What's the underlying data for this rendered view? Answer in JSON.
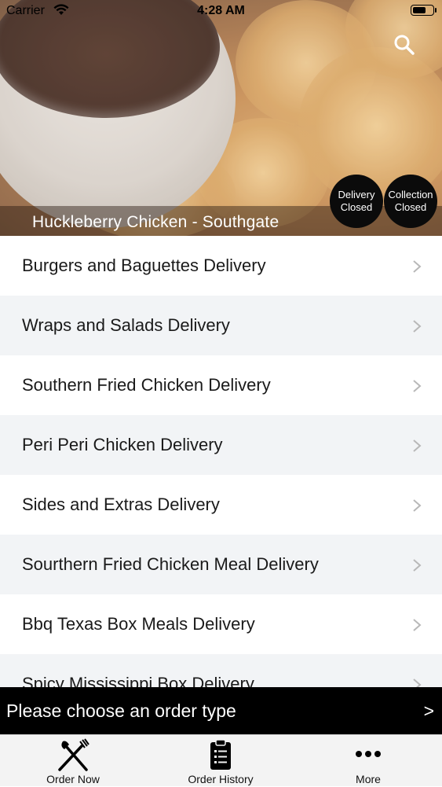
{
  "status_bar": {
    "carrier": "Carrier",
    "time": "4:28 AM"
  },
  "hero": {
    "restaurant_name": "Huckleberry Chicken - Southgate",
    "delivery_badge": [
      "Delivery",
      "Closed"
    ],
    "collection_badge": [
      "Collection",
      "Closed"
    ],
    "search_icon": "search-icon"
  },
  "menu": {
    "items": [
      {
        "label": "Burgers and Baguettes Delivery"
      },
      {
        "label": "Wraps and Salads Delivery"
      },
      {
        "label": "Southern Fried Chicken Delivery"
      },
      {
        "label": "Peri Peri Chicken Delivery"
      },
      {
        "label": "Sides and Extras Delivery"
      },
      {
        "label": "Sourthern Fried Chicken Meal Delivery"
      },
      {
        "label": "Bbq Texas Box Meals Delivery"
      },
      {
        "label": "Spicy Mississippi Box Delivery"
      }
    ]
  },
  "order_bar": {
    "label": "Please choose an order type",
    "arrow": ">"
  },
  "tabs": [
    {
      "label": "Order Now",
      "icon": "fork-knife-icon"
    },
    {
      "label": "Order History",
      "icon": "clipboard-list-icon"
    },
    {
      "label": "More",
      "icon": "more-dots-icon"
    }
  ],
  "colors": {
    "order_bar_bg": "#000000",
    "badge_bg": "#0b0b0b",
    "alt_row_bg": "#f2f4f6"
  }
}
